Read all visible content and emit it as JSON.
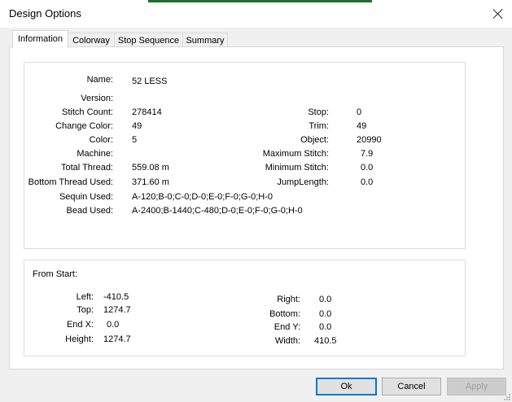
{
  "window": {
    "title": "Design Options"
  },
  "tabs": [
    "Information",
    "Colorway",
    "Stop Sequence",
    "Summary"
  ],
  "info": {
    "left_fields": [
      {
        "label": "Name:",
        "value": "52 LESS"
      },
      {
        "label": "Version:",
        "value": ""
      },
      {
        "label": "Stitch Count:",
        "value": "278414"
      },
      {
        "label": "Change Color:",
        "value": "49"
      },
      {
        "label": "Color:",
        "value": "5"
      },
      {
        "label": "Machine:",
        "value": ""
      },
      {
        "label": "Total Thread:",
        "value": "559.08 m"
      },
      {
        "label": "Bottom Thread Used:",
        "value": "371.60 m"
      },
      {
        "label": "Sequin Used:",
        "value": "A-120;B-0;C-0;D-0;E-0;F-0;G-0;H-0"
      },
      {
        "label": "Bead Used:",
        "value": "A-2400;B-1440;C-480;D-0;E-0;F-0;G-0;H-0"
      }
    ],
    "right_fields": [
      {
        "label": "Stop:",
        "value": "0"
      },
      {
        "label": "Trim:",
        "value": "49"
      },
      {
        "label": "Object:",
        "value": "20990"
      },
      {
        "label": "Maximum Stitch:",
        "value": "7.9"
      },
      {
        "label": "Minimum Stitch:",
        "value": "0.0"
      },
      {
        "label": "JumpLength:",
        "value": "0.0"
      }
    ]
  },
  "from_start": {
    "heading": "From Start:",
    "left_fields": [
      {
        "label": "Left:",
        "value": "-410.5"
      },
      {
        "label": "Top:",
        "value": "1274.7"
      },
      {
        "label": "End X:",
        "value": "0.0"
      },
      {
        "label": "Height:",
        "value": "1274.7"
      }
    ],
    "right_fields": [
      {
        "label": "Right:",
        "value": "0.0"
      },
      {
        "label": "Bottom:",
        "value": "0.0"
      },
      {
        "label": "End Y:",
        "value": "0.0"
      },
      {
        "label": "Width:",
        "value": "410.5"
      }
    ]
  },
  "buttons": {
    "ok": "Ok",
    "cancel": "Cancel",
    "apply": "Apply"
  }
}
